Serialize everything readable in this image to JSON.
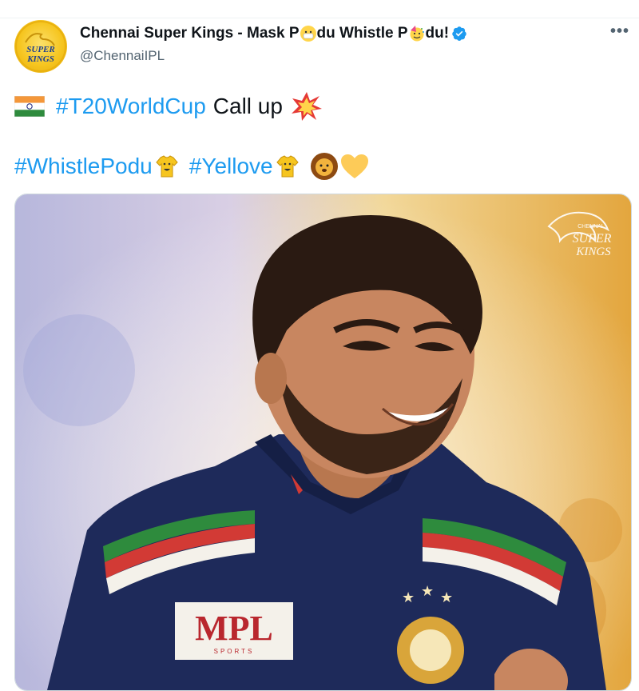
{
  "tweet": {
    "display_name": "Chennai Super Kings - Mask P",
    "name_mid": "du Whistle P",
    "name_end": "du!",
    "handle": "@ChennaiIPL",
    "more_label": "•••",
    "line1": {
      "hashtag": "#T20WorldCup",
      "text": "Call up"
    },
    "line2": {
      "hashtag1": "#WhistlePodu",
      "hashtag2": "#Yellove"
    },
    "media": {
      "logo_text_top": "CHENNAI",
      "logo_text_mid": "SUPER",
      "logo_text_bottom": "KINGS",
      "jersey_sponsor": "MPL",
      "jersey_sponsor_sub": "SPORTS"
    },
    "avatar": {
      "top": "SUPER",
      "bottom": "KINGS"
    },
    "colors": {
      "link": "#1d9bf0",
      "verified": "#1d9bf0",
      "jersey": "#1e2a5a",
      "csk_yellow": "#f6c51f"
    }
  }
}
